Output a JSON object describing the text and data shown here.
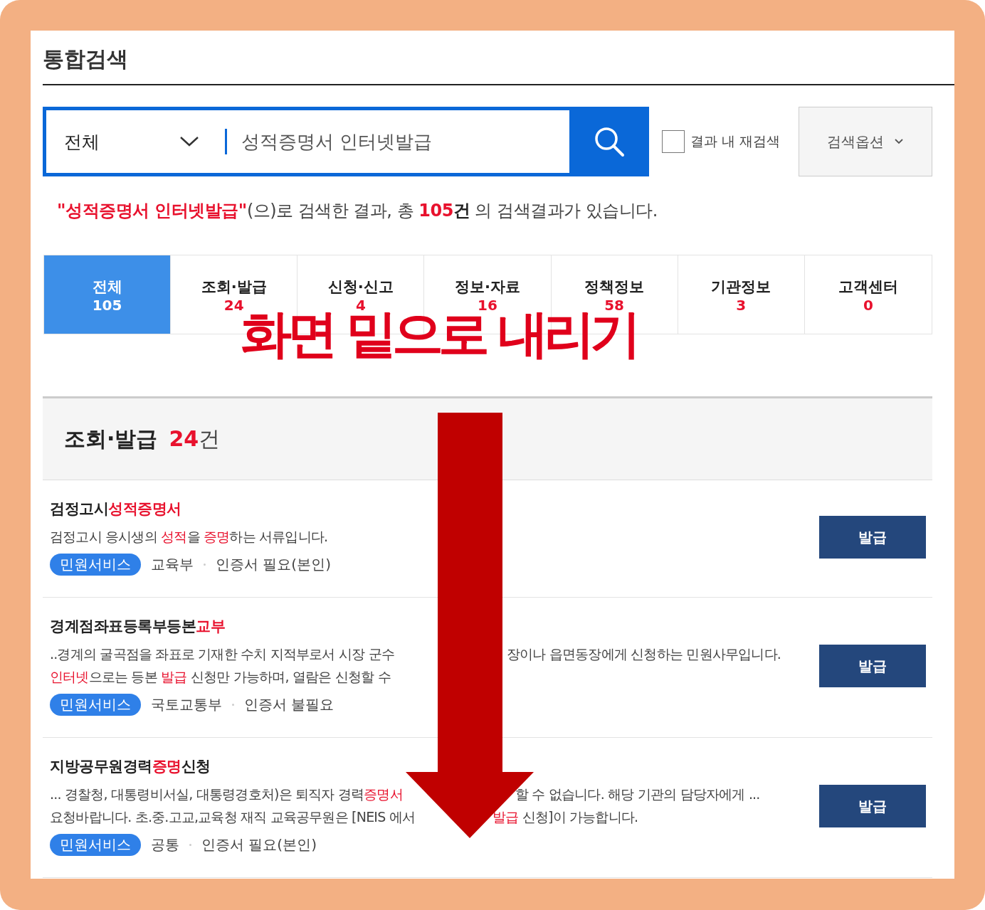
{
  "title": "통합검색",
  "search": {
    "scope": "전체",
    "value": "성적증명서 인터넷발급",
    "refine": {
      "label": "결과 내 재검색",
      "checked": false
    },
    "options": "검색옵션"
  },
  "summary": [
    {
      "t": "\"성적증명서 인터넷발급\"",
      "kind": "query"
    },
    {
      "t": "(으)로 검색한 결과, 총 ",
      "kind": "plain"
    },
    {
      "t": "105",
      "kind": "count"
    },
    {
      "t": "건",
      "kind": "bold"
    },
    {
      "t": " 의 검색결과가 있습니다.",
      "kind": "plain"
    }
  ],
  "tabs": [
    {
      "label": "전체",
      "count": "105",
      "selected": true
    },
    {
      "label": "조회·발급",
      "count": "24",
      "selected": false
    },
    {
      "label": "신청·신고",
      "count": "4",
      "selected": false
    },
    {
      "label": "정보·자료",
      "count": "16",
      "selected": false
    },
    {
      "label": "정책정보",
      "count": "58",
      "selected": false
    },
    {
      "label": "기관정보",
      "count": "3",
      "selected": false
    },
    {
      "label": "고객센터",
      "count": "0",
      "selected": false
    }
  ],
  "section": {
    "title": "조회·발급",
    "count": "24",
    "unit": "건"
  },
  "items": [
    {
      "title": [
        {
          "t": "검정고시",
          "hl": false
        },
        {
          "t": "성적증명서",
          "hl": true
        }
      ],
      "lines": [
        [
          [
            {
              "t": "검정고시 응시생의 ",
              "hl": false
            },
            {
              "t": "성적",
              "hl": true
            },
            {
              "t": "을 ",
              "hl": false
            },
            {
              "t": "증명",
              "hl": true
            },
            {
              "t": "하는 서류입니다.",
              "hl": false
            }
          ]
        ]
      ],
      "tag": "민원서비스",
      "meta": [
        "교육부",
        "인증서 필요(본인)"
      ],
      "button": "발급"
    },
    {
      "title": [
        {
          "t": "경계점좌표등록부등본",
          "hl": false
        },
        {
          "t": "교부",
          "hl": true
        }
      ],
      "lines": [
        [
          [
            {
              "t": "..경계의 굴곡점을 좌표로 기재한 수치 지적부로서 시장 군수",
              "hl": false
            }
          ],
          [
            {
              "t": "장이나 읍면동장에게 신청하는 민원사무입니다.",
              "hl": false
            }
          ]
        ],
        [
          [
            {
              "t": "인터넷",
              "hl": true
            },
            {
              "t": "으로는 등본 ",
              "hl": false
            },
            {
              "t": "발급",
              "hl": true
            },
            {
              "t": " 신청만 가능하며, 열람은 신청할 수",
              "hl": false
            }
          ]
        ]
      ],
      "tag": "민원서비스",
      "meta": [
        "국토교통부",
        "인증서 불필요"
      ],
      "button": "발급"
    },
    {
      "title": [
        {
          "t": "지방공무원경력",
          "hl": false
        },
        {
          "t": "증명",
          "hl": true
        },
        {
          "t": "신청",
          "hl": false
        }
      ],
      "lines": [
        [
          [
            {
              "t": "... 경찰청, 대통령비서실, 대통령경호처)은 퇴직자 경력",
              "hl": false
            },
            {
              "t": "증명서",
              "hl": true
            }
          ],
          [
            {
              "t": "할 수 없습니다. 해당 기관의 담당자에게 ...",
              "hl": false
            }
          ]
        ],
        [
          [
            {
              "t": "요청바랍니다. 초.중.고교,교육청 재직 교육공무원은 [NEIS 에서",
              "hl": false
            }
          ],
          [
            {
              "t": "발급",
              "hl": true
            },
            {
              "t": " 신청]이 가능합니다.",
              "hl": false
            }
          ]
        ]
      ],
      "tag": "민원서비스",
      "meta": [
        "공통",
        "인증서 필요(본인)"
      ],
      "button": "발급"
    }
  ],
  "annotation": {
    "text": "화면 밑으로 내리기"
  }
}
